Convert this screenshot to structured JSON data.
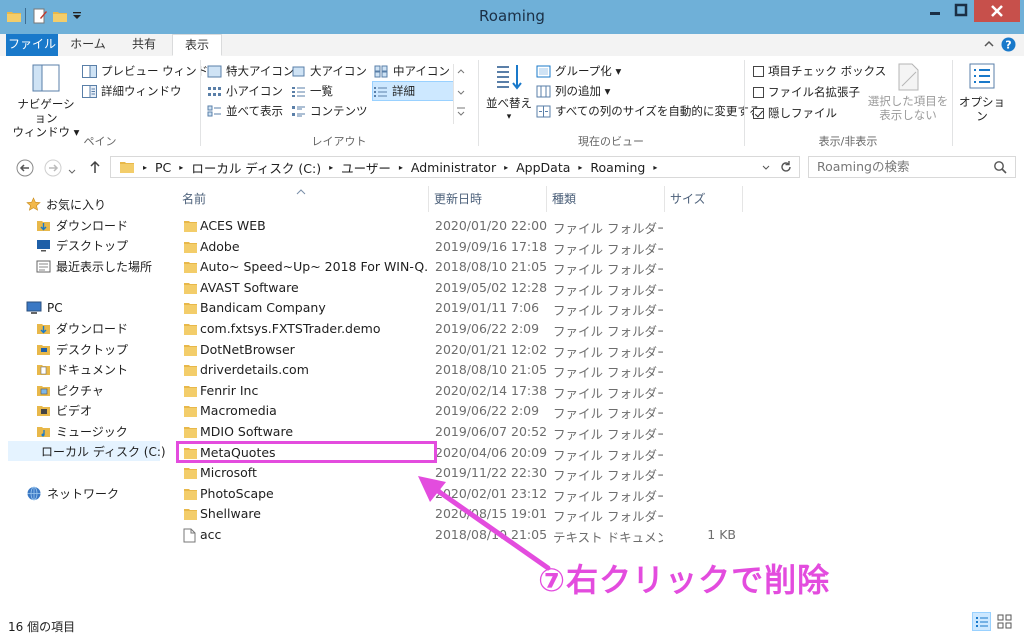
{
  "window": {
    "title": "Roaming"
  },
  "colors": {
    "accent": "#1979ca",
    "folder": "#e8b84a",
    "annotation": "#e34cde",
    "selection": "#cde8ff"
  },
  "tabs": [
    {
      "label": "ファイル"
    },
    {
      "label": "ホーム"
    },
    {
      "label": "共有"
    },
    {
      "label": "表示"
    }
  ],
  "ribbon": {
    "pane": {
      "nav_pane_line1": "ナビゲーション",
      "nav_pane_line2": "ウィンドウ ▾",
      "preview": "プレビュー ウィンドウ",
      "details": "詳細ウィンドウ",
      "label": "ペイン"
    },
    "layout": {
      "items": [
        "特大アイコン",
        "大アイコン",
        "中アイコン",
        "小アイコン",
        "一覧",
        "詳細",
        "並べて表示",
        "コンテンツ"
      ],
      "label": "レイアウト"
    },
    "current_view": {
      "sort_line1": "並べ替え",
      "group": "グループ化 ▾",
      "add_column": "列の追加 ▾",
      "fit_columns": "すべての列のサイズを自動的に変更する",
      "label": "現在のビュー"
    },
    "show_hide": {
      "item_checkbox": "項目チェック ボックス",
      "ext": "ファイル名拡張子",
      "hidden": "隠しファイル",
      "hide_selected_line1": "選択した項目を",
      "hide_selected_line2": "表示しない",
      "label": "表示/非表示"
    },
    "options": "オプション"
  },
  "address": {
    "crumbs": [
      "PC",
      "ローカル ディスク (C:)",
      "ユーザー",
      "Administrator",
      "AppData",
      "Roaming"
    ]
  },
  "search": {
    "placeholder": "Roamingの検索"
  },
  "nav": {
    "favorites": "お気に入り",
    "downloads1": "ダウンロード",
    "desktop1": "デスクトップ",
    "recent": "最近表示した場所",
    "pc": "PC",
    "downloads2": "ダウンロード",
    "desktop2": "デスクトップ",
    "documents": "ドキュメント",
    "pictures": "ピクチャ",
    "videos": "ビデオ",
    "music": "ミュージック",
    "localdisk": "ローカル ディスク (C:)",
    "network": "ネットワーク"
  },
  "columns": {
    "name": "名前",
    "date": "更新日時",
    "type": "種類",
    "size": "サイズ"
  },
  "files": [
    {
      "name": "ACES WEB",
      "date": "2020/01/20 22:00",
      "type": "ファイル フォルダー",
      "size": ""
    },
    {
      "name": "Adobe",
      "date": "2019/09/16 17:18",
      "type": "ファイル フォルダー",
      "size": ""
    },
    {
      "name": "Auto~ Speed~Up~ 2018 For WIN-Q...",
      "date": "2018/08/10 21:05",
      "type": "ファイル フォルダー",
      "size": ""
    },
    {
      "name": "AVAST Software",
      "date": "2019/05/02 12:28",
      "type": "ファイル フォルダー",
      "size": ""
    },
    {
      "name": "Bandicam Company",
      "date": "2019/01/11 7:06",
      "type": "ファイル フォルダー",
      "size": ""
    },
    {
      "name": "com.fxtsys.FXTSTrader.demo",
      "date": "2019/06/22 2:09",
      "type": "ファイル フォルダー",
      "size": ""
    },
    {
      "name": "DotNetBrowser",
      "date": "2020/01/21 12:02",
      "type": "ファイル フォルダー",
      "size": ""
    },
    {
      "name": "driverdetails.com",
      "date": "2018/08/10 21:05",
      "type": "ファイル フォルダー",
      "size": ""
    },
    {
      "name": "Fenrir Inc",
      "date": "2020/02/14 17:38",
      "type": "ファイル フォルダー",
      "size": ""
    },
    {
      "name": "Macromedia",
      "date": "2019/06/22 2:09",
      "type": "ファイル フォルダー",
      "size": ""
    },
    {
      "name": "MDIO Software",
      "date": "2019/06/07 20:52",
      "type": "ファイル フォルダー",
      "size": ""
    },
    {
      "name": "MetaQuotes",
      "date": "2020/04/06 20:09",
      "type": "ファイル フォルダー",
      "size": ""
    },
    {
      "name": "Microsoft",
      "date": "2019/11/22 22:30",
      "type": "ファイル フォルダー",
      "size": ""
    },
    {
      "name": "PhotoScape",
      "date": "2020/02/01 23:12",
      "type": "ファイル フォルダー",
      "size": ""
    },
    {
      "name": "Shellware",
      "date": "2020/08/15 19:01",
      "type": "ファイル フォルダー",
      "size": ""
    },
    {
      "name": "acc",
      "date": "2018/08/10 21:05",
      "type": "テキスト ドキュメント",
      "size": "1 KB"
    }
  ],
  "status": {
    "count": "16 個の項目"
  },
  "annotation": {
    "text": "⑦右クリックで削除"
  }
}
